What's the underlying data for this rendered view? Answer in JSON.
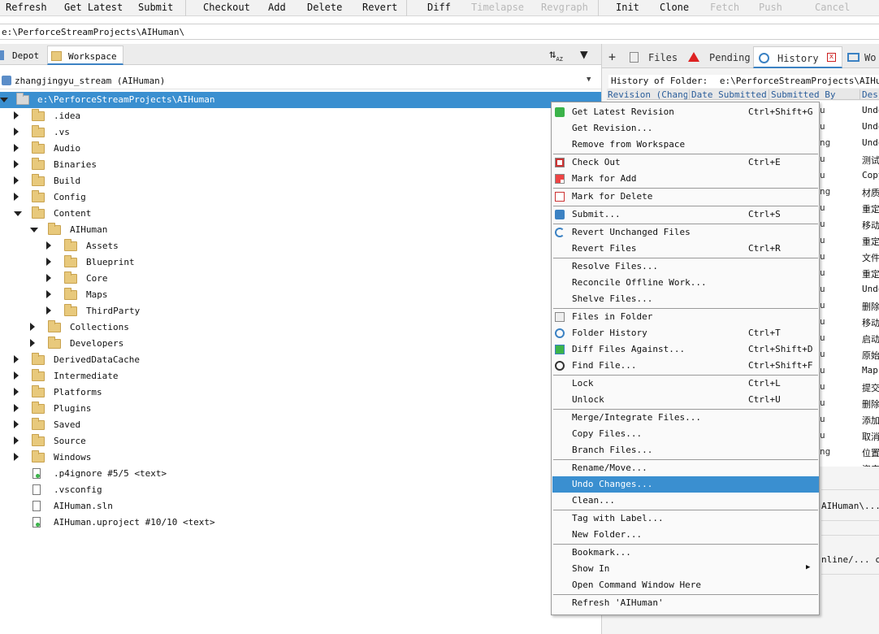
{
  "toolbar": {
    "buttons": [
      {
        "label": "Refresh",
        "enabled": true
      },
      {
        "label": "Get Latest",
        "enabled": true
      },
      {
        "label": "Submit",
        "enabled": true
      },
      {
        "label": "Checkout",
        "enabled": true
      },
      {
        "label": "Add",
        "enabled": true
      },
      {
        "label": "Delete",
        "enabled": true
      },
      {
        "label": "Revert",
        "enabled": true
      },
      {
        "label": "Diff",
        "enabled": true
      },
      {
        "label": "Timelapse",
        "enabled": false
      },
      {
        "label": "Revgraph",
        "enabled": false
      },
      {
        "label": "Init",
        "enabled": true
      },
      {
        "label": "Clone",
        "enabled": true
      },
      {
        "label": "Fetch",
        "enabled": false
      },
      {
        "label": "Push",
        "enabled": false
      },
      {
        "label": "Cancel",
        "enabled": false
      }
    ]
  },
  "path_bar": {
    "value": "e:\\PerforceStreamProjects\\AIHuman\\"
  },
  "left_pane": {
    "tabs": [
      {
        "label": "Depot",
        "active": false
      },
      {
        "label": "Workspace",
        "active": true
      }
    ],
    "stream_selector": {
      "value": "zhangjingyu_stream (AIHuman)"
    },
    "tree": [
      {
        "label": "e:\\PerforceStreamProjects\\AIHuman",
        "type": "folder",
        "expanded": true,
        "selected": true
      },
      {
        "label": ".idea",
        "type": "folder",
        "expanded": false
      },
      {
        "label": ".vs",
        "type": "folder",
        "expanded": false
      },
      {
        "label": "Audio",
        "type": "folder",
        "expanded": false
      },
      {
        "label": "Binaries",
        "type": "folder",
        "expanded": false
      },
      {
        "label": "Build",
        "type": "folder",
        "expanded": false
      },
      {
        "label": "Config",
        "type": "folder",
        "expanded": false
      },
      {
        "label": "Content",
        "type": "folder",
        "expanded": true
      },
      {
        "label": "AIHuman",
        "type": "folder",
        "expanded": true
      },
      {
        "label": "Assets",
        "type": "folder",
        "expanded": false
      },
      {
        "label": "Blueprint",
        "type": "folder",
        "expanded": false
      },
      {
        "label": "Core",
        "type": "folder",
        "expanded": false
      },
      {
        "label": "Maps",
        "type": "folder",
        "expanded": false
      },
      {
        "label": "ThirdParty",
        "type": "folder",
        "expanded": false
      },
      {
        "label": "Collections",
        "type": "folder",
        "expanded": false
      },
      {
        "label": "Developers",
        "type": "folder",
        "expanded": false
      },
      {
        "label": "DerivedDataCache",
        "type": "folder",
        "expanded": false
      },
      {
        "label": "Intermediate",
        "type": "folder",
        "expanded": false
      },
      {
        "label": "Platforms",
        "type": "folder",
        "expanded": false
      },
      {
        "label": "Plugins",
        "type": "folder",
        "expanded": false
      },
      {
        "label": "Saved",
        "type": "folder",
        "expanded": false
      },
      {
        "label": "Source",
        "type": "folder",
        "expanded": false
      },
      {
        "label": "Windows",
        "type": "folder",
        "expanded": false
      },
      {
        "label": ".p4ignore #5/5 <text>",
        "type": "file-tracked"
      },
      {
        "label": ".vsconfig",
        "type": "file"
      },
      {
        "label": "AIHuman.sln",
        "type": "file"
      },
      {
        "label": "AIHuman.uproject #10/10 <text>",
        "type": "file-tracked"
      }
    ]
  },
  "right_pane": {
    "tabs": [
      {
        "label": "Files",
        "icon": "files-icon"
      },
      {
        "label": "Pending",
        "icon": "pending-icon"
      },
      {
        "label": "History",
        "icon": "history-icon",
        "active": true
      },
      {
        "label": "Wo",
        "icon": "workspace-icon"
      }
    ],
    "history_header": {
      "label": "History of Folder:",
      "path": "e:\\PerforceStreamProjects\\AIHuman"
    },
    "columns": [
      "Revision (Change",
      "Date Submitted",
      "Submitted By",
      "Desc"
    ],
    "rows": [
      {
        "by": "u",
        "desc": "Undo"
      },
      {
        "by": "u",
        "desc": "Undo"
      },
      {
        "by": "ng",
        "desc": "Undo"
      },
      {
        "by": "u",
        "desc": "测试"
      },
      {
        "by": "u",
        "desc": "Copy"
      },
      {
        "by": "ng",
        "desc": "材质"
      },
      {
        "by": "u",
        "desc": "重定"
      },
      {
        "by": "u",
        "desc": "移动"
      },
      {
        "by": "u",
        "desc": "重定"
      },
      {
        "by": "u",
        "desc": "文件"
      },
      {
        "by": "u",
        "desc": "重定"
      },
      {
        "by": "u",
        "desc": "Undo"
      },
      {
        "by": "u",
        "desc": "删除"
      },
      {
        "by": "u",
        "desc": "移动"
      },
      {
        "by": "u",
        "desc": "启动"
      },
      {
        "by": "u",
        "desc": "原始"
      },
      {
        "by": "u",
        "desc": "Maps"
      },
      {
        "by": "u",
        "desc": "提交"
      },
      {
        "by": "u",
        "desc": "删除"
      },
      {
        "by": "u",
        "desc": "添加"
      },
      {
        "by": "u",
        "desc": "取消"
      },
      {
        "by": "ng",
        "desc": "位置"
      },
      {
        "by": "",
        "desc": "资产"
      }
    ],
    "detail_line1": "AIHuman\\...@",
    "detail_line2": "nline/... che"
  },
  "context_menu": {
    "groups": [
      [
        {
          "label": "Get Latest Revision",
          "shortcut": "Ctrl+Shift+G",
          "icon": "get-latest-icon"
        },
        {
          "label": "Get Revision...",
          "shortcut": ""
        },
        {
          "label": "Remove from Workspace",
          "shortcut": ""
        }
      ],
      [
        {
          "label": "Check Out",
          "shortcut": "Ctrl+E",
          "icon": "checkout-icon"
        },
        {
          "label": "Mark for Add",
          "shortcut": "",
          "icon": "mark-add-icon"
        }
      ],
      [
        {
          "label": "Mark for Delete",
          "shortcut": "",
          "icon": "mark-delete-icon"
        }
      ],
      [
        {
          "label": "Submit...",
          "shortcut": "Ctrl+S",
          "icon": "submit-icon"
        }
      ],
      [
        {
          "label": "Revert Unchanged Files",
          "shortcut": "",
          "icon": "revert-icon"
        },
        {
          "label": "Revert Files",
          "shortcut": "Ctrl+R"
        }
      ],
      [
        {
          "label": "Resolve Files...",
          "shortcut": ""
        },
        {
          "label": "Reconcile Offline Work...",
          "shortcut": ""
        },
        {
          "label": "Shelve Files...",
          "shortcut": ""
        }
      ],
      [
        {
          "label": "Files in Folder",
          "shortcut": "",
          "icon": "files-in-folder-icon"
        },
        {
          "label": "Folder History",
          "shortcut": "Ctrl+T",
          "icon": "folder-history-icon"
        },
        {
          "label": "Diff Files Against...",
          "shortcut": "Ctrl+Shift+D",
          "icon": "diff-icon"
        },
        {
          "label": "Find File...",
          "shortcut": "Ctrl+Shift+F",
          "icon": "find-icon"
        }
      ],
      [
        {
          "label": "Lock",
          "shortcut": "Ctrl+L"
        },
        {
          "label": "Unlock",
          "shortcut": "Ctrl+U"
        }
      ],
      [
        {
          "label": "Merge/Integrate Files...",
          "shortcut": ""
        },
        {
          "label": "Copy Files...",
          "shortcut": ""
        },
        {
          "label": "Branch Files...",
          "shortcut": ""
        }
      ],
      [
        {
          "label": "Rename/Move...",
          "shortcut": ""
        },
        {
          "label": "Undo Changes...",
          "shortcut": "",
          "highlighted": true
        },
        {
          "label": "Clean...",
          "shortcut": ""
        }
      ],
      [
        {
          "label": "Tag with Label...",
          "shortcut": ""
        },
        {
          "label": "New Folder...",
          "shortcut": ""
        }
      ],
      [
        {
          "label": "Bookmark...",
          "shortcut": ""
        },
        {
          "label": "Show In",
          "shortcut": "",
          "submenu": true
        },
        {
          "label": "Open Command Window Here",
          "shortcut": ""
        }
      ],
      [
        {
          "label": "Refresh 'AIHuman'",
          "shortcut": ""
        }
      ]
    ]
  }
}
